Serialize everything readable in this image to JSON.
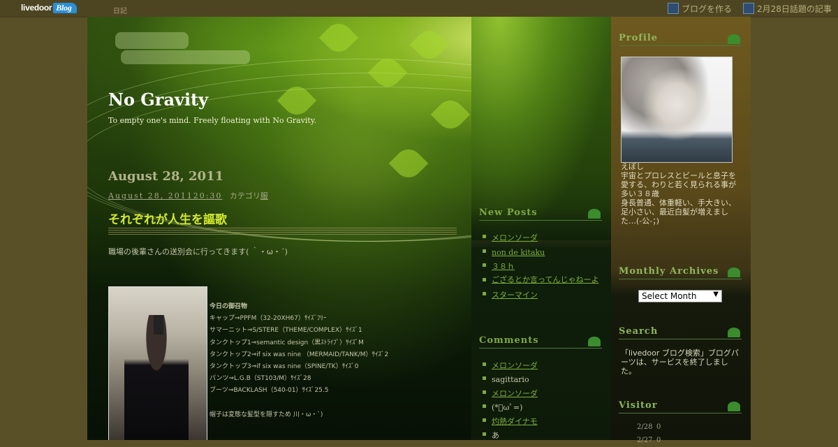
{
  "topbar": {
    "logo_text": "livedoor",
    "logo_badge": "Blog",
    "diary": "日記",
    "make_blog": "ブログを作る",
    "topic": "2月28日話題の記事"
  },
  "blog": {
    "title": "No Gravity",
    "description": "To empty one's mind. Freely floating with No Gravity."
  },
  "post": {
    "date_heading": "August 28, 2011",
    "timestamp": "August 28, 201120:30",
    "category_label": "カテゴリ",
    "category_value": "服",
    "title": "それぞれが人生を謳歌",
    "body": "職場の後輩さんの送別会に行ってきます( ｀・ω・´)",
    "outfit": [
      "今日の御召物",
      "キャップ⇒PPFM（32-20XH67）ｻｲｽﾞﾌﾘｰ",
      "サマーニット⇒S/STERE（THEME/COMPLEX）ｻｲｽﾞ1",
      "タンクトップ1⇒semantic design（黒ｽﾄﾗｲﾌﾟ）ｻｲｽﾞM",
      "タンクトップ2⇒if six was nine （MERMAID/TANK/M）ｻｲｽﾞ2",
      "タンクトップ3⇒if six was nine（SPINE/TK）ｻｲｽﾞ0",
      "パンツ⇒L.G.B（ST103/M）ｻｲｽﾞ28",
      "ブーツ⇒BACKLASH（540-01）ｻｲｽﾞ25.5",
      "",
      "帽子は変態な髪型を隠すため 川・ω・`)"
    ]
  },
  "new_posts": {
    "title": "New Posts",
    "items": [
      "メロンソーダ",
      "non de kitaku",
      "３８ｈ",
      "ござるとか言ってんじゃねーよ",
      "スターマイン"
    ]
  },
  "comments": {
    "title": "Comments",
    "items": [
      {
        "link": "メロンソーダ",
        "author": "sagittario"
      },
      {
        "link": "メロンソーダ",
        "author": "(*ﾟωﾟ=)"
      },
      {
        "link": "灼熱ダイナモ",
        "author": "あ"
      }
    ]
  },
  "profile": {
    "title": "Profile",
    "text": "えぼし\n宇宙とプロレスとビールと息子を愛する、わりと若く見られる事が多い３８歳\n身長普通、体重軽い、手大きい、足小さい、最近白髪が増えました…(-公-；)"
  },
  "archives": {
    "title": "Monthly Archives",
    "select_value": "Select Month"
  },
  "search": {
    "title": "Search",
    "text": "「livedoor ブログ検索」ブログパーツは、サービスを終了しました。"
  },
  "visitor": {
    "title": "Visitor",
    "rows": [
      {
        "date": "2/28",
        "count": "0"
      },
      {
        "date": "2/27",
        "count": "0"
      }
    ]
  },
  "colors": {
    "accent_green": "#7fb03c",
    "title_yellow": "#d4e92d",
    "top_bar": "#4d4522"
  }
}
